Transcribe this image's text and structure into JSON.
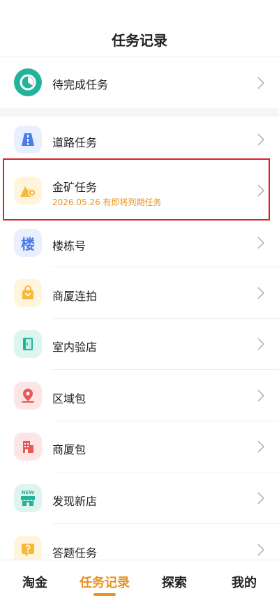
{
  "header": {
    "title": "任务记录"
  },
  "pending": {
    "label": "待完成任务",
    "icon": "clock-icon",
    "color": "#23b39b"
  },
  "tasks": [
    {
      "label": "道路任务",
      "icon": "road-icon",
      "color": "#4b7bec",
      "bg": "#e8efff"
    },
    {
      "label": "金矿任务",
      "sub": "2026.05.26 有即将到期任务",
      "icon": "gold-mine-icon",
      "color": "#f6b93b",
      "bg": "#fff4dc"
    },
    {
      "label": "楼栋号",
      "icon": "building-number-icon",
      "glyph": "楼",
      "color": "#4b7bec",
      "bg": "#e8efff"
    },
    {
      "label": "商厦连拍",
      "icon": "shopping-bag-icon",
      "color": "#f6b93b",
      "bg": "#fff4dc"
    },
    {
      "label": "室内验店",
      "icon": "door-icon",
      "color": "#23b39b",
      "bg": "#ddf5ef"
    },
    {
      "label": "区域包",
      "icon": "map-pin-icon",
      "color": "#eb5757",
      "bg": "#fde5e5"
    },
    {
      "label": "商厦包",
      "icon": "office-building-icon",
      "color": "#eb5757",
      "bg": "#fde5e5"
    },
    {
      "label": "发现新店",
      "icon": "new-store-icon",
      "glyph": "NEW",
      "color": "#23b39b",
      "bg": "#ddf5ef"
    },
    {
      "label": "答题任务",
      "icon": "question-icon",
      "color": "#f6b93b",
      "bg": "#fff4dc"
    }
  ],
  "tabs": [
    {
      "label": "淘金"
    },
    {
      "label": "任务记录",
      "active": true
    },
    {
      "label": "探索"
    },
    {
      "label": "我的"
    }
  ],
  "colors": {
    "accent": "#e8921f",
    "highlight_border": "#d8232a"
  }
}
